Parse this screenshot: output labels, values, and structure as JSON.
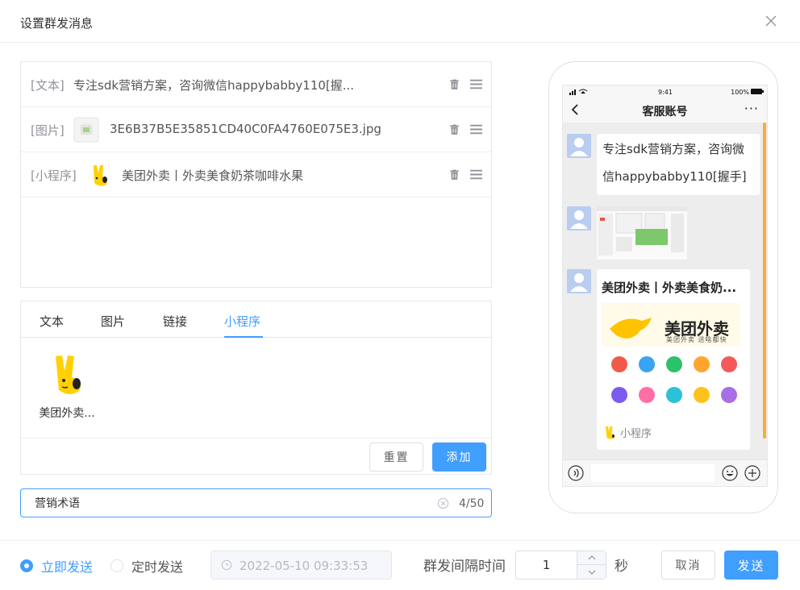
{
  "dialog": {
    "title": "设置群发消息"
  },
  "messages": [
    {
      "type": "[文本]",
      "text": "专注sdk营销方案，咨询微信happybabby110[握..."
    },
    {
      "type": "[图片]",
      "text": "3E6B37B5E35851CD40C0FA4760E075E3.jpg"
    },
    {
      "type": "[小程序]",
      "text": "美团外卖丨外卖美食奶茶咖啡水果"
    }
  ],
  "tabs": [
    {
      "label": "文本"
    },
    {
      "label": "图片"
    },
    {
      "label": "链接"
    },
    {
      "label": "小程序",
      "active": true
    }
  ],
  "miniprogram_card": {
    "label": "美团外卖..."
  },
  "editor_buttons": {
    "reset": "重置",
    "add": "添加"
  },
  "title_input": {
    "value": "营销术语",
    "counter": "4/50"
  },
  "phone": {
    "status_time": "9:41",
    "status_battery": "100%",
    "chat_title": "客服账号",
    "more": "···",
    "text_bubble": "专注sdk营销方案，咨询微信happybabby110[握手]",
    "mp_bubble_title": "美团外卖丨外卖美食奶...",
    "mp_footer": "小程序"
  },
  "footer": {
    "send_now": "立即发送",
    "send_scheduled": "定时发送",
    "send_mode": "send_now",
    "date_value": "2022-05-10 09:33:53",
    "interval_label": "群发间隔时间",
    "interval_value": "1",
    "interval_unit": "秒",
    "cancel": "取消",
    "send": "发送"
  },
  "colors": {
    "accent": "#409eff",
    "scroll": "#f7ad3b",
    "avatar": "#b8cdf0"
  }
}
